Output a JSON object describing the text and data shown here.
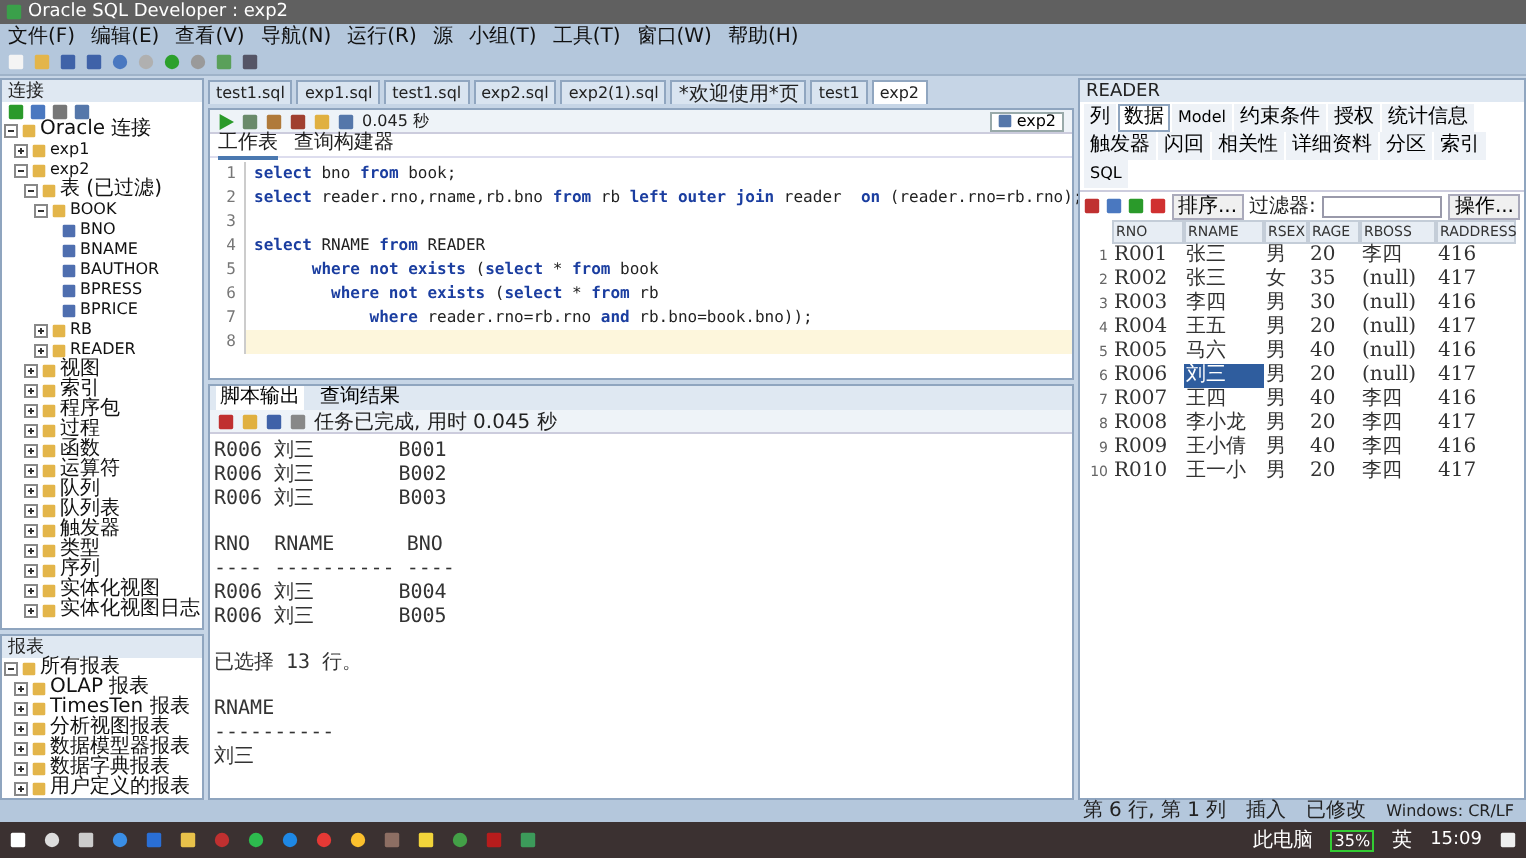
{
  "window": {
    "title": "Oracle SQL Developer : exp2"
  },
  "menu": [
    "文件(F)",
    "编辑(E)",
    "查看(V)",
    "导航(N)",
    "运行(R)",
    "源",
    "小组(T)",
    "工具(T)",
    "窗口(W)",
    "帮助(H)"
  ],
  "connections_panel": {
    "title": "连接",
    "tree": [
      {
        "label": "Oracle 连接",
        "expanded": true,
        "children": [
          {
            "label": "exp1",
            "expanded": false
          },
          {
            "label": "exp2",
            "expanded": true,
            "children": [
              {
                "label": "表 (已过滤)",
                "expanded": true,
                "children": [
                  {
                    "label": "BOOK",
                    "expanded": true,
                    "children": [
                      {
                        "label": "BNO"
                      },
                      {
                        "label": "BNAME"
                      },
                      {
                        "label": "BAUTHOR"
                      },
                      {
                        "label": "BPRESS"
                      },
                      {
                        "label": "BPRICE"
                      }
                    ]
                  },
                  {
                    "label": "RB",
                    "expanded": false
                  },
                  {
                    "label": "READER",
                    "expanded": false
                  }
                ]
              },
              {
                "label": "视图",
                "expanded": false
              },
              {
                "label": "索引",
                "expanded": false
              },
              {
                "label": "程序包",
                "expanded": false
              },
              {
                "label": "过程",
                "expanded": false
              },
              {
                "label": "函数",
                "expanded": false
              },
              {
                "label": "运算符",
                "expanded": false
              },
              {
                "label": "队列",
                "expanded": false
              },
              {
                "label": "队列表",
                "expanded": false
              },
              {
                "label": "触发器",
                "expanded": false
              },
              {
                "label": "类型",
                "expanded": false
              },
              {
                "label": "序列",
                "expanded": false
              },
              {
                "label": "实体化视图",
                "expanded": false
              },
              {
                "label": "实体化视图日志",
                "expanded": false
              }
            ]
          }
        ]
      }
    ]
  },
  "reports_panel": {
    "title": "报表",
    "tree": [
      {
        "label": "所有报表",
        "expanded": true,
        "children": [
          {
            "label": "OLAP 报表",
            "expanded": false
          },
          {
            "label": "TimesTen 报表",
            "expanded": false
          },
          {
            "label": "分析视图报表",
            "expanded": false
          },
          {
            "label": "数据模型器报表",
            "expanded": false
          },
          {
            "label": "数据字典报表",
            "expanded": false
          },
          {
            "label": "用户定义的报表",
            "expanded": false
          }
        ]
      }
    ]
  },
  "editor_tabs": [
    {
      "label": "test1.sql",
      "selected": false
    },
    {
      "label": "exp1.sql",
      "selected": false
    },
    {
      "label": "test1.sql",
      "selected": false
    },
    {
      "label": "exp2.sql",
      "selected": false
    },
    {
      "label": "exp2(1).sql",
      "selected": false
    },
    {
      "label": "*欢迎使用*页",
      "selected": false
    },
    {
      "label": "test1",
      "selected": false
    },
    {
      "label": "exp2",
      "selected": true
    }
  ],
  "editor": {
    "timing": "0.045 秒",
    "connection": "exp2",
    "subtabs": [
      {
        "label": "工作表",
        "selected": true
      },
      {
        "label": "查询构建器",
        "selected": false
      }
    ],
    "lines": [
      {
        "number": "1",
        "current": false,
        "code": "**select** bno **from** book;"
      },
      {
        "number": "2",
        "current": false,
        "code": "**select** reader.rno,rname,rb.bno **from** rb **left outer join** reader  **on** (reader.rno=rb.rno);"
      },
      {
        "number": "3",
        "current": false
      },
      {
        "number": "4",
        "current": false,
        "code": "**select** RNAME **from** READER"
      },
      {
        "number": "5",
        "current": false,
        "code": "      **where not exists** (**select** * **from** book"
      },
      {
        "number": "6",
        "current": false,
        "code": "        **where not exists** (**select** * **from** rb"
      },
      {
        "number": "7",
        "current": false,
        "code": "            **where** reader.rno=rb.rno **and** rb.bno=book.bno));"
      },
      {
        "number": "8",
        "current": true
      }
    ]
  },
  "output": {
    "tabs": [
      {
        "label": "脚本输出",
        "selected": true
      },
      {
        "label": "查询结果",
        "selected": false
      }
    ],
    "status": "任务已完成, 用时 0.045 秒",
    "blocks": [
      [
        "R006 刘三       B001",
        "R006 刘三       B002",
        "R006 刘三       B003"
      ],
      [
        "RNO  RNAME      BNO",
        "---- ---------- ----",
        "R006 刘三       B004",
        "R006 刘三       B005"
      ],
      [
        "已选择 13 行。"
      ],
      [
        "RNAME",
        "----------",
        "刘三"
      ]
    ]
  },
  "table_panel": {
    "title": "READER",
    "tabs": [
      {
        "label": "列",
        "selected": false
      },
      {
        "label": "数据",
        "selected": true
      },
      {
        "label": "Model",
        "selected": false
      },
      {
        "label": "约束条件",
        "selected": false
      },
      {
        "label": "授权",
        "selected": false
      },
      {
        "label": "统计信息",
        "selected": false
      },
      {
        "label": "触发器",
        "selected": false
      },
      {
        "label": "闪回",
        "selected": false
      },
      {
        "label": "相关性",
        "selected": false
      },
      {
        "label": "详细资料",
        "selected": false
      },
      {
        "label": "分区",
        "selected": false
      },
      {
        "label": "索引",
        "selected": false
      },
      {
        "label": "SQL",
        "selected": false
      }
    ],
    "sort_button": "排序...",
    "filter_label": "过滤器:",
    "actions_button": "操作...",
    "columns": [
      "RNO",
      "RNAME",
      "RSEX",
      "RAGE",
      "RBOSS",
      "RADDRESS"
    ],
    "rows": [
      {
        "num": "1",
        "selected": false,
        "cells": [
          "R001",
          "张三",
          "男",
          "20",
          "李四",
          "416"
        ]
      },
      {
        "num": "2",
        "selected": false,
        "cells": [
          "R002",
          "张三",
          "女",
          "35",
          "(null)",
          "417"
        ]
      },
      {
        "num": "3",
        "selected": false,
        "cells": [
          "R003",
          "李四",
          "男",
          "30",
          "(null)",
          "416"
        ]
      },
      {
        "num": "4",
        "selected": false,
        "cells": [
          "R004",
          "王五",
          "男",
          "20",
          "(null)",
          "417"
        ]
      },
      {
        "num": "5",
        "selected": false,
        "cells": [
          "R005",
          "马六",
          "男",
          "40",
          "(null)",
          "416"
        ]
      },
      {
        "num": "6",
        "selected": true,
        "cells": [
          "R006",
          "刘三",
          "男",
          "20",
          "(null)",
          "417"
        ]
      },
      {
        "num": "7",
        "selected": false,
        "cells": [
          "R007",
          "王四",
          "男",
          "40",
          "李四",
          "416"
        ]
      },
      {
        "num": "8",
        "selected": false,
        "cells": [
          "R008",
          "李小龙",
          "男",
          "20",
          "李四",
          "417"
        ]
      },
      {
        "num": "9",
        "selected": false,
        "cells": [
          "R009",
          "王小倩",
          "男",
          "40",
          "李四",
          "416"
        ]
      },
      {
        "num": "10",
        "selected": false,
        "cells": [
          "R010",
          "王一小",
          "男",
          "20",
          "李四",
          "417"
        ]
      }
    ]
  },
  "status_bar": [
    "第 6 行, 第 1 列",
    "插入",
    "已修改",
    "Windows: CR/LF"
  ],
  "taskbar": {
    "computer": "此电脑",
    "battery": "35%",
    "language": "英",
    "time": "15:09"
  }
}
